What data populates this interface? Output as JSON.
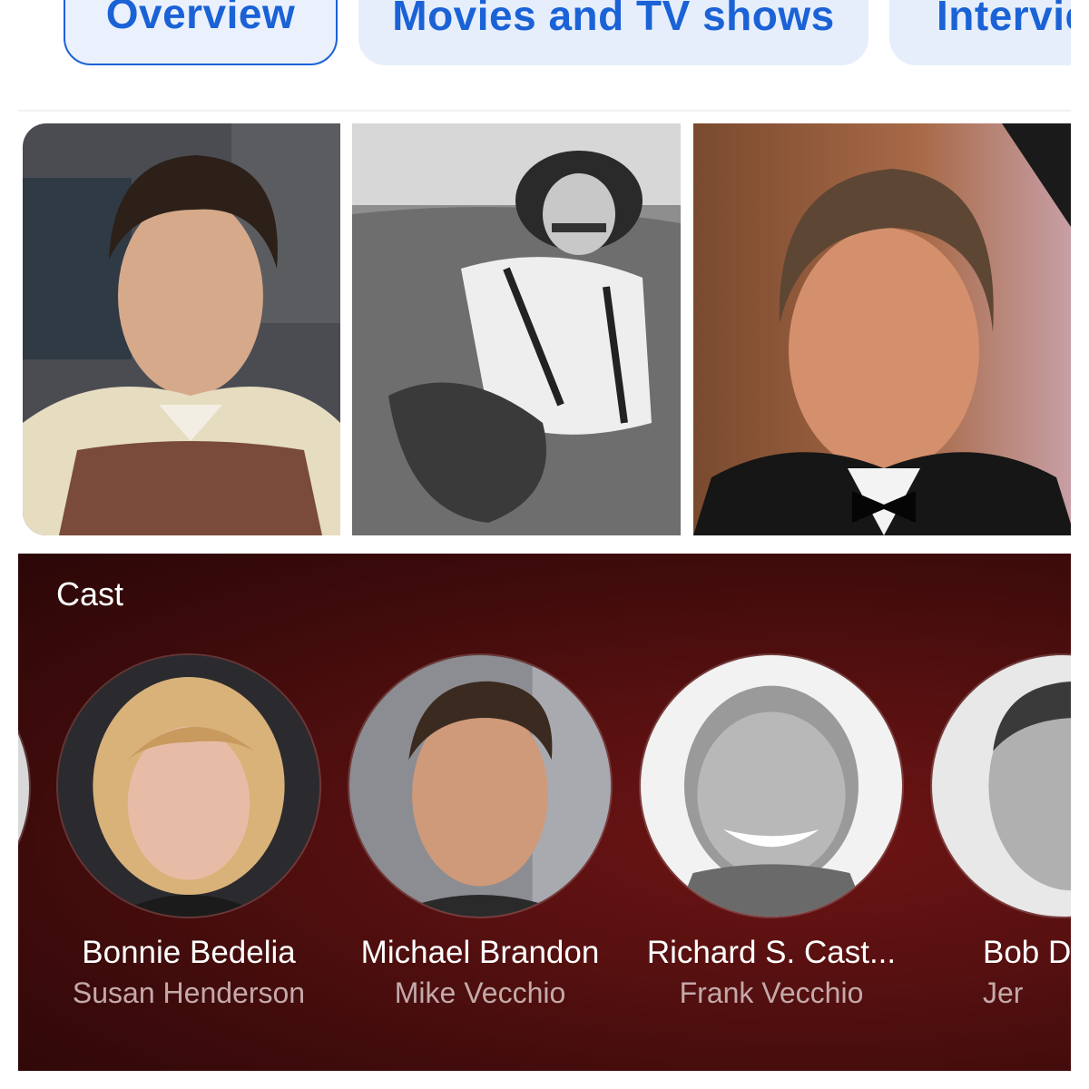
{
  "tabs": [
    {
      "label": "Overview",
      "selected": true
    },
    {
      "label": "Movies and TV shows",
      "selected": false
    },
    {
      "label": "Intervie",
      "selected": false
    }
  ],
  "photos": [
    {
      "alt": "Young man in patterned sweater vest"
    },
    {
      "alt": "Black and white photo of man with mustache lying on the floor"
    },
    {
      "alt": "Older man in tuxedo smiling"
    }
  ],
  "cast": {
    "heading": "Cast",
    "members": [
      {
        "name": "Bonnie Bedelia",
        "role": "Susan Henderson"
      },
      {
        "name": "Michael Brandon",
        "role": "Mike Vecchio"
      },
      {
        "name": "Richard S. Cast...",
        "role": "Frank Vecchio"
      },
      {
        "name": "Bob D",
        "role": "Jer"
      }
    ]
  },
  "colors": {
    "accent": "#1a62d6",
    "chip_bg": "#e6eefc",
    "cast_bg": "#4a0d0d"
  }
}
